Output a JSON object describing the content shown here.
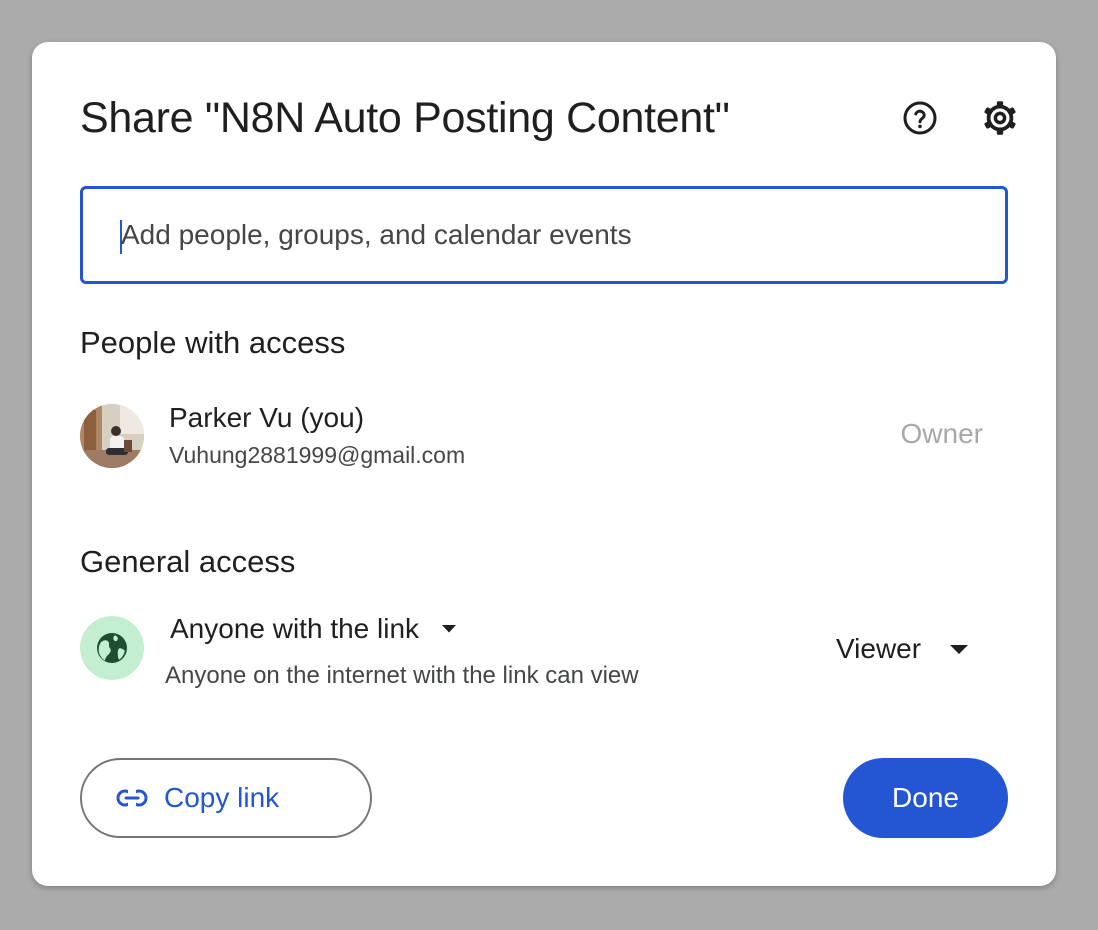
{
  "dialog": {
    "title": "Share \"N8N Auto Posting Content\"",
    "help_icon": "help-circle-icon",
    "settings_icon": "gear-icon"
  },
  "add_people": {
    "placeholder": "Add people, groups, and calendar events",
    "value": ""
  },
  "people_with_access": {
    "heading": "People with access",
    "people": [
      {
        "name": "Parker Vu (you)",
        "email": "Vuhung2881999@gmail.com",
        "role": "Owner",
        "avatar": "user-photo"
      }
    ]
  },
  "general_access": {
    "heading": "General access",
    "icon": "globe-icon",
    "selection": "Anyone with the link",
    "description": "Anyone on the internet with the link can view",
    "role": "Viewer"
  },
  "footer": {
    "copy_link_label": "Copy link",
    "copy_link_icon": "link-icon",
    "done_label": "Done"
  },
  "colors": {
    "backdrop": "#ababab",
    "accent": "#2456d3",
    "globe_bg": "#c4eed0",
    "globe_fg": "#1e4d32",
    "muted_text": "#a8a8a8"
  }
}
